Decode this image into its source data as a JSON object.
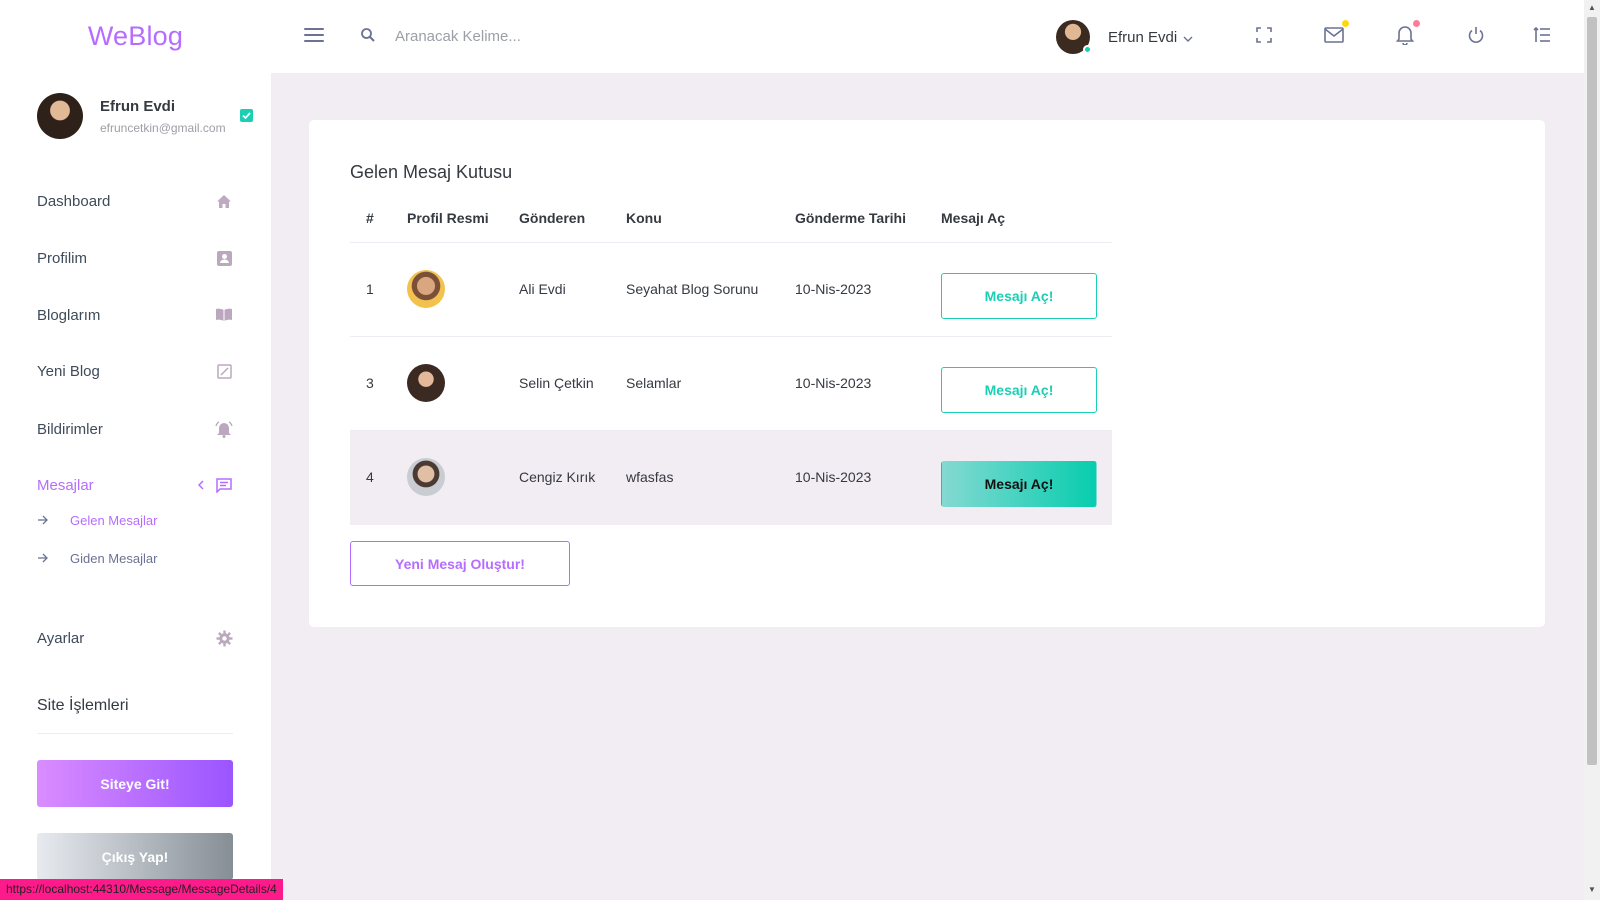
{
  "brand": "WeBlog",
  "search": {
    "placeholder": "Aranacak Kelime..."
  },
  "topbar": {
    "user_name": "Efrun Evdi",
    "icons": [
      "fullscreen-icon",
      "mail-icon",
      "bell-icon",
      "power-icon",
      "list-icon"
    ],
    "mail_badge_color": "#fed713",
    "bell_badge_color": "#fe7c96"
  },
  "sidebar": {
    "profile": {
      "name": "Efrun Evdi",
      "email": "efruncetkin@gmail.com"
    },
    "items": [
      {
        "label": "Dashboard",
        "icon": "home-icon"
      },
      {
        "label": "Profilim",
        "icon": "contact-icon"
      },
      {
        "label": "Bloglarım",
        "icon": "book-icon"
      },
      {
        "label": "Yeni Blog",
        "icon": "edit-icon"
      },
      {
        "label": "Bildirimler",
        "icon": "bell-icon"
      },
      {
        "label": "Mesajlar",
        "icon": "message-icon",
        "active": true
      }
    ],
    "subitems": [
      {
        "label": "Gelen Mesajlar",
        "active": true
      },
      {
        "label": "Giden Mesajlar"
      }
    ],
    "settings": {
      "label": "Ayarlar",
      "icon": "gear-icon"
    },
    "section_title": "Site İşlemleri",
    "site_button": "Siteye Git!",
    "logout_button": "Çıkış Yap!"
  },
  "inbox": {
    "title": "Gelen Mesaj Kutusu",
    "columns": [
      "#",
      "Profil Resmi",
      "Gönderen",
      "Konu",
      "Gönderme Tarihi",
      "Mesajı Aç"
    ],
    "rows": [
      {
        "id": "1",
        "sender": "Ali Evdi",
        "subject": "Seyahat Blog Sorunu",
        "date": "10-Nis-2023",
        "action": "Mesajı Aç!"
      },
      {
        "id": "3",
        "sender": "Selin Çetkin",
        "subject": "Selamlar",
        "date": "10-Nis-2023",
        "action": "Mesajı Aç!"
      },
      {
        "id": "4",
        "sender": "Cengiz Kırık",
        "subject": "wfasfas",
        "date": "10-Nis-2023",
        "action": "Mesajı Aç!"
      }
    ],
    "new_message_button": "Yeni Mesaj Oluştur!"
  },
  "status_url": "https://localhost:44310/Message/MessageDetails/4",
  "colors": {
    "primary": "#b66dff",
    "success": "#1bcfb4",
    "background": "#f2edf3"
  }
}
